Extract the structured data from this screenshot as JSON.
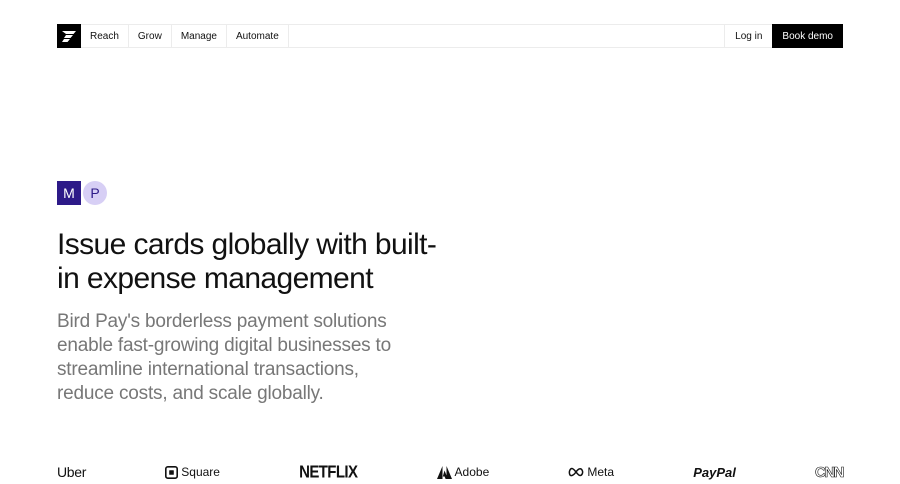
{
  "nav": {
    "items": [
      {
        "label": "Reach"
      },
      {
        "label": "Grow"
      },
      {
        "label": "Manage"
      },
      {
        "label": "Automate"
      }
    ],
    "login_label": "Log in",
    "demo_label": "Book demo"
  },
  "avatars": {
    "first": "M",
    "second": "P"
  },
  "hero": {
    "headline": "Issue cards globally with built-in expense management",
    "subhead": "Bird Pay's borderless payment solutions enable fast-growing digital businesses to streamline international transactions, reduce costs, and scale globally."
  },
  "brands": {
    "uber": "Uber",
    "square": "Square",
    "netflix": "NETFLIX",
    "adobe": "Adobe",
    "meta": "Meta",
    "paypal": "PayPal",
    "cnn": "CNN"
  },
  "colors": {
    "accent": "#2d1a88",
    "accent_light": "#d7cff5",
    "subtext": "#777777"
  }
}
